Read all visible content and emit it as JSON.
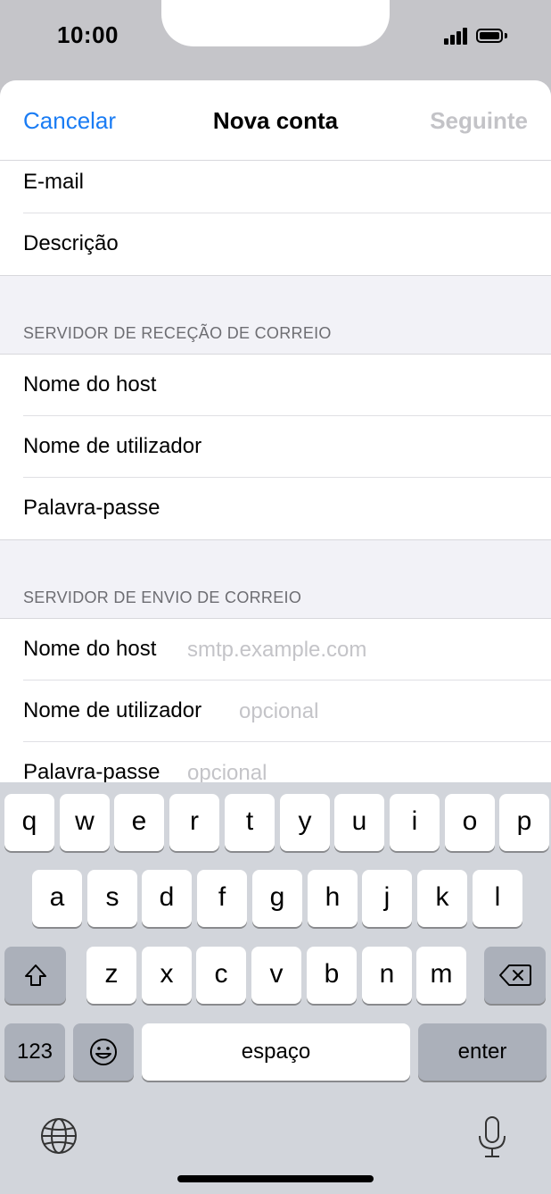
{
  "status_bar": {
    "time": "10:00"
  },
  "nav": {
    "cancel_label": "Cancelar",
    "title": "Nova conta",
    "next_label": "Seguinte"
  },
  "account": {
    "email_label": "E-mail",
    "description_label": "Descrição"
  },
  "incoming": {
    "header": "SERVIDOR DE RECEÇÃO DE CORREIO",
    "host_label": "Nome do host",
    "username_label": "Nome de utilizador",
    "password_label": "Palavra-passe"
  },
  "outgoing": {
    "header": "SERVIDOR DE ENVIO DE CORREIO",
    "host_label": "Nome do host",
    "host_placeholder": "smtp.example.com",
    "username_label": "Nome de utilizador",
    "username_placeholder": "opcional",
    "password_label": "Palavra-passe",
    "password_placeholder": "opcional"
  },
  "keyboard": {
    "row1": [
      "q",
      "w",
      "e",
      "r",
      "t",
      "y",
      "u",
      "i",
      "o",
      "p"
    ],
    "row2": [
      "a",
      "s",
      "d",
      "f",
      "g",
      "h",
      "j",
      "k",
      "l"
    ],
    "row3": [
      "z",
      "x",
      "c",
      "v",
      "b",
      "n",
      "m"
    ],
    "numbers_label": "123",
    "space_label": "espaço",
    "enter_label": "enter",
    "icons": {
      "shift": "shift-icon",
      "backspace": "backspace-icon",
      "emoji": "emoji-icon",
      "globe": "globe-icon",
      "mic": "microphone-icon"
    }
  },
  "colors": {
    "accent": "#1a7cf4",
    "disabled": "#c3c3c7",
    "keyboard_bg": "#d2d5db"
  }
}
